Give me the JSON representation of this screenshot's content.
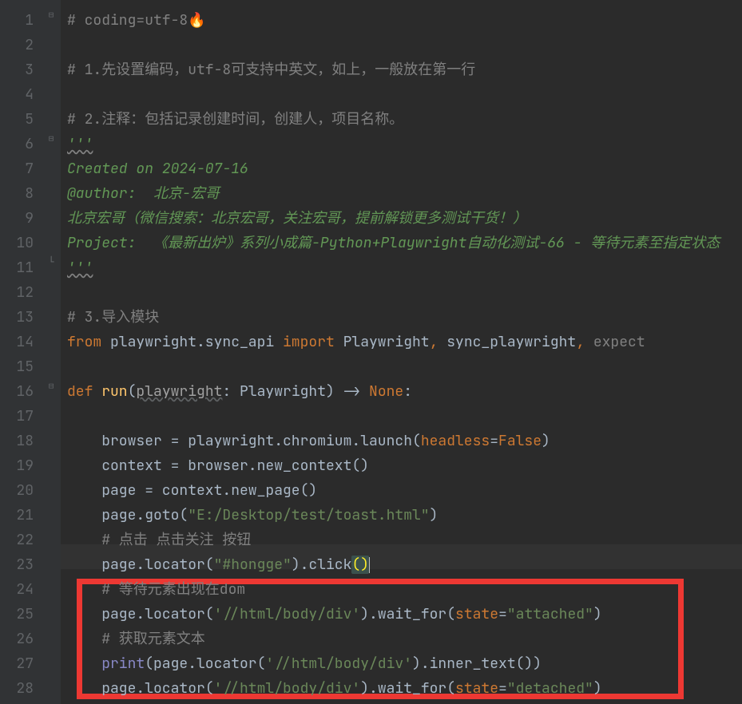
{
  "lineNumbers": [
    "1",
    "2",
    "3",
    "4",
    "5",
    "6",
    "7",
    "8",
    "9",
    "10",
    "11",
    "12",
    "13",
    "14",
    "15",
    "16",
    "17",
    "18",
    "19",
    "20",
    "21",
    "22",
    "23",
    "24",
    "25",
    "26",
    "27",
    "28"
  ],
  "code": {
    "l1": {
      "cmt": "# coding=utf-8",
      "fire": "🔥"
    },
    "l3": {
      "cmt": "# 1.先设置编码，utf-8可支持中英文，如上，一般放在第一行"
    },
    "l5": {
      "cmt": "# 2.注释：包括记录创建时间，创建人，项目名称。"
    },
    "l6": {
      "docq": "'''"
    },
    "l7": {
      "doc": "Created on 2024-07-16"
    },
    "l8": {
      "doc": "@author:  北京-宏哥"
    },
    "l9": {
      "doc": "北京宏哥（微信搜索：北京宏哥，关注宏哥，提前解锁更多测试干货！）"
    },
    "l10": {
      "doc": "Project:  《最新出炉》系列小成篇-Python+Playwright自动化测试-66 - 等待元素至指定状态"
    },
    "l11": {
      "docq": "'''"
    },
    "l13": {
      "cmt": "# 3.导入模块"
    },
    "l14": {
      "kw1": "from ",
      "mod": "playwright.sync_api ",
      "kw2": "import ",
      "imp1": "Playwright",
      "comma1": ", ",
      "imp2": "sync_playwright",
      "comma2": ", ",
      "imp3": "expect"
    },
    "l16": {
      "kw": "def ",
      "fn": "run",
      "lp": "(",
      "param": "playwright",
      "colon": ": Playwright) -> ",
      "none": "None",
      "end": ":"
    },
    "l18": {
      "lhs": "    browser = playwright.chromium.launch(",
      "kwarg": "headless",
      "eq": "=",
      "val": "False",
      "rp": ")"
    },
    "l19": {
      "txt": "    context = browser.new_context()"
    },
    "l20": {
      "txt": "    page = context.new_page()"
    },
    "l21": {
      "pre": "    page.goto(",
      "str": "\"E:/Desktop/test/toast.html\"",
      "post": ")"
    },
    "l22": {
      "cmt": "    # 点击 点击关注 按钮"
    },
    "l23": {
      "pre": "    page.locator(",
      "str": "\"#hongge\"",
      "mid": ").click",
      "paren": "()"
    },
    "l24": {
      "cmt": "    # 等待元素出现在dom"
    },
    "l25": {
      "pre": "    page.locator(",
      "str": "'//html/body/div'",
      "mid": ").wait_for(",
      "kwarg": "state",
      "eq": "=",
      "val": "\"attached\"",
      "rp": ")"
    },
    "l26": {
      "cmt": "    # 获取元素文本"
    },
    "l27": {
      "pre": "    ",
      "print": "print",
      "mid1": "(page.locator(",
      "str": "'//html/body/div'",
      "mid2": ").inner_text())"
    },
    "l28": {
      "pre": "    page.locator(",
      "str": "'//html/body/div'",
      "mid": ").wait_for(",
      "kwarg": "state",
      "eq": "=",
      "val": "\"detached\"",
      "rp": ")"
    }
  }
}
